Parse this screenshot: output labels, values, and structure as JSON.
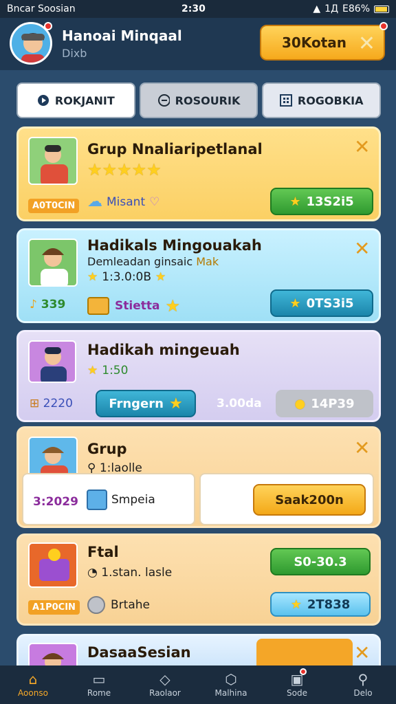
{
  "status": {
    "carrier": "Bncar Soosian",
    "time": "2:30",
    "right": "1Д",
    "battery": "E86%"
  },
  "header": {
    "name": "Hanoai Minqaal",
    "sub": "Dixb",
    "button_label": "30Kotan"
  },
  "tabs": [
    {
      "label": "ROKJANIT",
      "icon": "play-icon"
    },
    {
      "label": "ROSOURIK",
      "icon": "circle-minus-icon"
    },
    {
      "label": "ROGOBKIA",
      "icon": "grid-icon"
    }
  ],
  "cards": [
    {
      "title": "Grup Nnaliaripetlanal",
      "stars": "★★★★★",
      "badge": "A0T0CIN",
      "meta": "Misant",
      "pill": "13S2i5"
    },
    {
      "title": "Hadikals Mingouakah",
      "line2": "Demleadan ginsaic",
      "line2b": "Mak",
      "line3": "1:3.0:0B",
      "count": "339",
      "meta": "Stietta",
      "pill": "0TS3i5"
    },
    {
      "title": "Hadikah mingeuah",
      "line2": "1:50",
      "count": "2220",
      "pill1": "Frngern",
      "middle": "3.00da",
      "pill2": "14P39"
    },
    {
      "title": "Grup",
      "line2": "1:laolle",
      "white_left_num": "3:2029",
      "white_left_label": "Smpeia",
      "white_right_button": "Saak200n"
    },
    {
      "title": "Ftal",
      "line2": "1.stan. lasle",
      "badge": "A1P0CIN",
      "meta": "Brtahe",
      "pill1": "S0-30.3",
      "pill2": "2T838"
    },
    {
      "title": "DasaaSesian"
    }
  ],
  "nav": [
    {
      "label": "Aoonso",
      "icon": "home-icon"
    },
    {
      "label": "Rome",
      "icon": "folder-icon"
    },
    {
      "label": "Raolaor",
      "icon": "tag-icon"
    },
    {
      "label": "Malhina",
      "icon": "box-icon"
    },
    {
      "label": "Sode",
      "icon": "chat-icon"
    },
    {
      "label": "Delo",
      "icon": "pin-icon"
    }
  ],
  "colors": {
    "accent": "#f7a928",
    "bg": "#2b4c6d",
    "green": "#2f9a30",
    "teal": "#1b86ab"
  }
}
